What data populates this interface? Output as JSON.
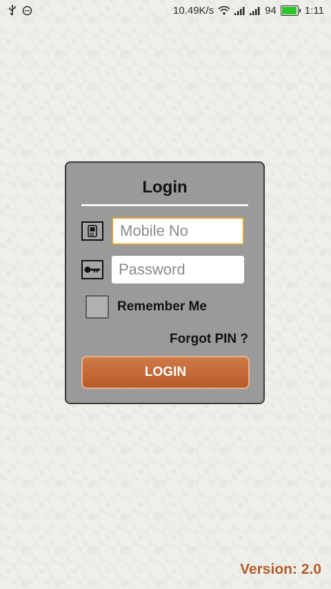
{
  "status_bar": {
    "network_speed": "10.49K/s",
    "battery_level": "94",
    "battery_fill_fraction": 0.94,
    "time": "1:11",
    "icons": [
      "usb-icon",
      "notification-icon",
      "wifi-icon",
      "signal-icon",
      "signal-icon",
      "battery-icon"
    ],
    "battery_color": "#2bc62b"
  },
  "login": {
    "title": "Login",
    "mobile": {
      "placeholder": "Mobile No",
      "value": "",
      "icon": "phone-icon"
    },
    "password": {
      "placeholder": "Password",
      "value": "",
      "icon": "key-icon"
    },
    "remember_label": "Remember Me",
    "remember_checked": false,
    "forgot_label": "Forgot PIN ?",
    "button_label": "LOGIN"
  },
  "footer": {
    "version": "Version: 2.0"
  },
  "colors": {
    "accent": "#c26a35",
    "version_text": "#b25d2a",
    "focus_border": "#d9a530"
  }
}
